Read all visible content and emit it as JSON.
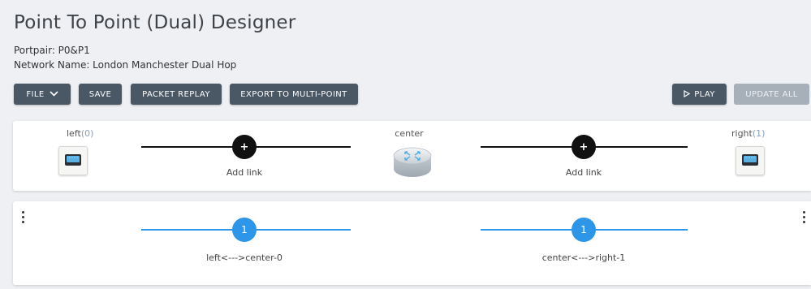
{
  "page": {
    "title": "Point To Point (Dual) Designer",
    "portpair": "Portpair: P0&P1",
    "network_name": "Network Name: London Manchester Dual Hop"
  },
  "toolbar": {
    "file_label": "FILE",
    "save_label": "SAVE",
    "packet_replay_label": "PACKET REPLAY",
    "export_label": "EXPORT TO MULTI-POINT",
    "play_label": "PLAY",
    "update_all_label": "UPDATE ALL"
  },
  "topology": {
    "left": {
      "label": "left",
      "count": "(0)"
    },
    "center": {
      "label": "center"
    },
    "right": {
      "label": "right",
      "count": "(1)"
    },
    "add_link_left": {
      "symbol": "+",
      "label": "Add link"
    },
    "add_link_right": {
      "symbol": "+",
      "label": "Add link"
    }
  },
  "links": {
    "link1": {
      "number": "1",
      "label": "left<--->center-0"
    },
    "link2": {
      "number": "1",
      "label": "center<--->right-1"
    }
  },
  "colors": {
    "button_bg": "#4a5866",
    "button_disabled_bg": "#a7afb8",
    "link_blue": "#2e96e8",
    "page_bg": "#eef0f4"
  }
}
